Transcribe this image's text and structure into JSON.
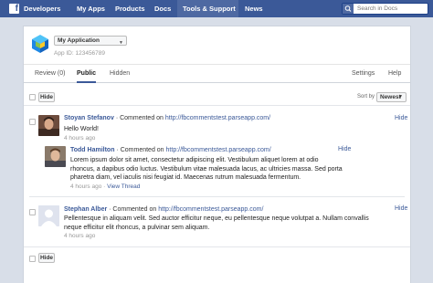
{
  "topnav": {
    "items": [
      {
        "label": "Developers"
      },
      {
        "label": "My Apps"
      },
      {
        "label": "Products"
      },
      {
        "label": "Docs"
      },
      {
        "label": "Tools & Support"
      },
      {
        "label": "News"
      }
    ],
    "search_placeholder": "Search in Docs"
  },
  "app": {
    "name": "My Application",
    "id_label": "App ID: 123456789"
  },
  "tabs": {
    "review": "Review (0)",
    "public": "Public",
    "hidden": "Hidden",
    "settings": "Settings",
    "help": "Help"
  },
  "toolbar": {
    "hide_label": "Hide",
    "sort_label": "Sort by",
    "sort_value": "Newest"
  },
  "comments": [
    {
      "author": "Stoyan Stefanov",
      "commented_on": "· Commented on",
      "url": "http://fbcommentstest.parseapp.com/",
      "text_lines": [
        "Hello World!"
      ],
      "time": "4 hours ago",
      "hide": "Hide",
      "reply": {
        "author": "Todd Hamilton",
        "commented_on": "· Commented on",
        "url": "http://fbcommentstest.parseapp.com/",
        "text_lines": [
          "Lorem ipsum dolor sit amet, consectetur adipiscing elit. Vestibulum aliquet lorem at odio",
          "rhoncus, a dapibus odio luctus. Vestibulum vitae malesuada lacus, ac ultricies massa. Sed porta",
          "pharetra diam, vel iaculis nisi feugiat id. Maecenas rutrum malesuada fermentum."
        ],
        "time": "4 hours ago",
        "view_thread": "View Thread",
        "hide": "Hide"
      }
    },
    {
      "author": "Stephan Alber",
      "commented_on": "· Commented on",
      "url": "http://fbcommentstest.parseapp.com/",
      "text_lines": [
        "Pellentesque in aliquam velit. Sed auctor efficitur neque, eu pellentesque neque volutpat a. Nullam convallis",
        "neque efficitur elit rhoncus, a pulvinar sem aliquam."
      ],
      "time": "4 hours ago",
      "hide": "Hide"
    }
  ],
  "footer": {
    "hide_label": "Hide"
  },
  "colors": {
    "brand": "#3b5998",
    "nav_active": "#4e69a2"
  }
}
